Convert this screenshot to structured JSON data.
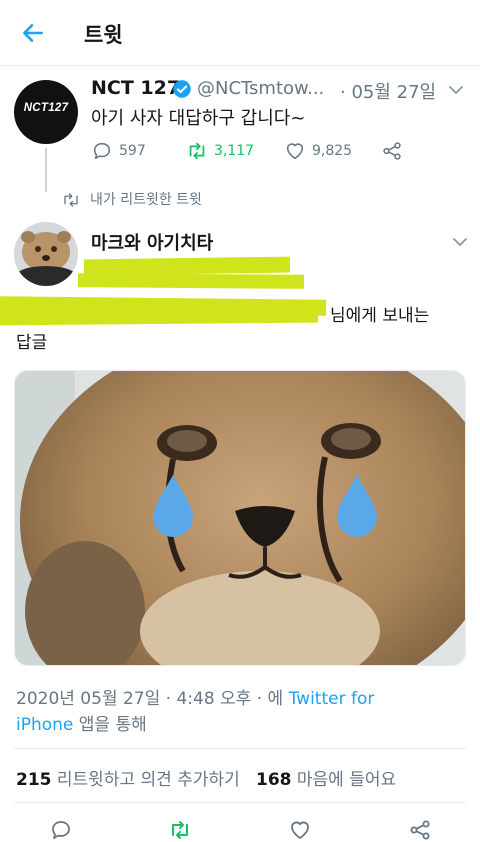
{
  "header": {
    "title": "트윗",
    "back_icon": "arrow-left-icon"
  },
  "quoted_tweet": {
    "avatar_text": "NCT127",
    "name": "NCT 127",
    "handle": "@NCTsmtow...",
    "date": "· 05월 27일",
    "text": "아기 사자 대답하구 갑니다~",
    "replies": "597",
    "retweets": "3,117",
    "likes": "9,825"
  },
  "retweet_notice": "내가 리트윗한 트윗",
  "main_tweet": {
    "name": "마크와 아기치타",
    "reply_to_suffix": "님에게 보내는",
    "reply_to_line2": "답글",
    "timestamp_prefix": "2020년 05월 27일 · 4:48 오후 · 에",
    "source_part1": "Twitter for",
    "source_part2": "iPhone",
    "source_suffix": "앱을 통해",
    "retweet_count": "215",
    "retweet_label": "리트윗하고 의견 추가하기",
    "like_count": "168",
    "like_label": "마음에 들어요"
  },
  "colors": {
    "accent": "#1da1f2",
    "retweet_green": "#17bf63",
    "secondary_text": "#657786",
    "highlighter": "#cfe41a",
    "teardrop": "#5aa8e8"
  }
}
